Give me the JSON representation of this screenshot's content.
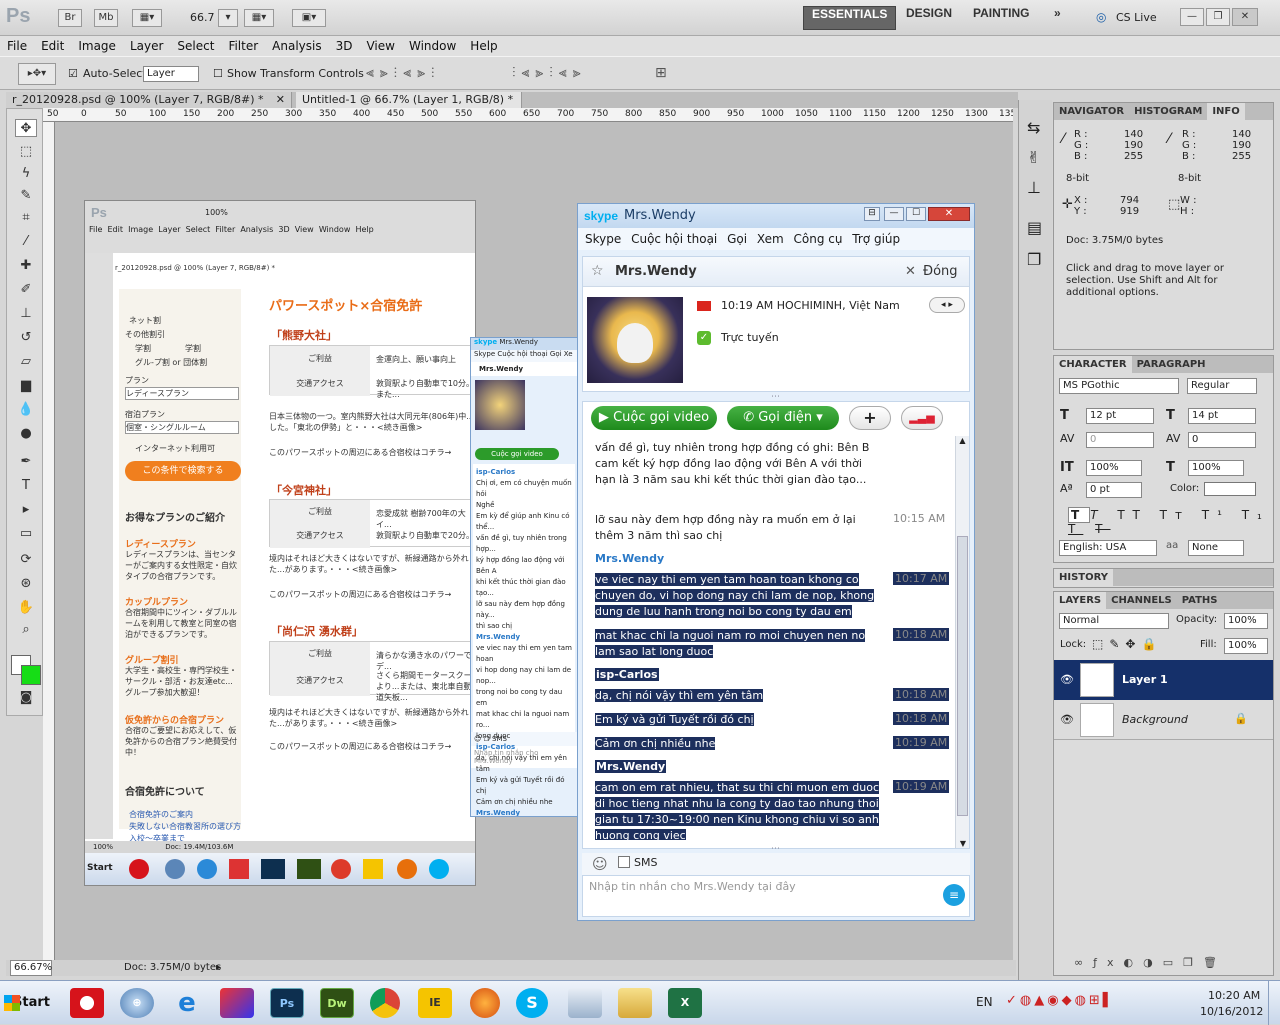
{
  "ps": {
    "logo": "Ps",
    "zoom": "66.7",
    "br": "Br",
    "mb": "Mb",
    "workspaces": [
      "ESSENTIALS",
      "DESIGN",
      "PAINTING"
    ],
    "cslive": "CS Live",
    "menu": [
      "File",
      "Edit",
      "Image",
      "Layer",
      "Select",
      "Filter",
      "Analysis",
      "3D",
      "View",
      "Window",
      "Help"
    ],
    "options": {
      "auto_select": "Auto-Select:",
      "auto_select_value": "Layer",
      "show_transform": "Show Transform Controls"
    },
    "doc_tabs": [
      "r_20120928.psd @ 100% (Layer 7, RGB/8#) *",
      "Untitled-1 @ 66.7% (Layer 1, RGB/8) *"
    ],
    "ruler": [
      "50",
      "0",
      "50",
      "100",
      "150",
      "200",
      "250",
      "300",
      "350",
      "400",
      "450",
      "500",
      "550",
      "600",
      "650",
      "700",
      "750",
      "800",
      "850",
      "900",
      "950",
      "1000",
      "1050",
      "1100",
      "1150",
      "1200",
      "1250",
      "1300",
      "135"
    ],
    "status_zoom": "66.67%",
    "status_doc": "Doc: 3.75M/0 bytes"
  },
  "panels": {
    "info_tabs": [
      "NAVIGATOR",
      "HISTOGRAM",
      "INFO"
    ],
    "info": {
      "r_lbl": "R :",
      "g_lbl": "G :",
      "b_lbl": "B :",
      "r": "140",
      "g": "190",
      "b": "255",
      "bit": "8-bit",
      "x_lbl": "X :",
      "y_lbl": "Y :",
      "x": "794",
      "y": "919",
      "w_lbl": "W :",
      "h_lbl": "H :",
      "doc": "Doc: 3.75M/0 bytes",
      "hint": "Click and drag to move layer or selection. Use Shift and Alt for additional options."
    },
    "char_tabs": [
      "CHARACTER",
      "PARAGRAPH"
    ],
    "char": {
      "font": "MS PGothic",
      "style": "Regular",
      "size": "12 pt",
      "leading": "14 pt",
      "kerning": "0",
      "tracking": "0",
      "vscale": "100%",
      "hscale": "100%",
      "baseline": "0 pt",
      "color_lbl": "Color:",
      "lang": "English: USA",
      "aa": "None",
      "aa_lbl": "aa"
    },
    "history": "HISTORY",
    "layer_tabs": [
      "LAYERS",
      "CHANNELS",
      "PATHS"
    ],
    "layers": {
      "mode": "Normal",
      "opacity_lbl": "Opacity:",
      "opacity": "100%",
      "lock_lbl": "Lock:",
      "fill_lbl": "Fill:",
      "fill": "100%",
      "items": [
        "Layer 1",
        "Background"
      ]
    }
  },
  "inner": {
    "logo": "Ps",
    "zoom": "100%",
    "menu": [
      "File",
      "Edit",
      "Image",
      "Layer",
      "Select",
      "Filter",
      "Analysis",
      "3D",
      "View",
      "Window",
      "Help"
    ],
    "tab": "r_20120928.psd @ 100% (Layer 7, RGB/8#) *",
    "status": "Doc: 19.4M/103.6M",
    "status_zoom": "100%",
    "heading": "パワースポット×合宿免許",
    "sections": [
      {
        "title": "「熊野大社」",
        "benefit": "金運向上、願い事向上",
        "access": "敦賀駅より自動車で10分。また...",
        "desc": "日本三体物の一つ。室内熊野大社は大同元年(806年)中...した。「東北の伊勢」と・・・<続き画像>",
        "more": "このパワースポットの周辺にある合宿校はコチラ→"
      },
      {
        "title": "「今宮神社」",
        "benefit": "恋愛成就 樹齢700年の大イ...",
        "access": "敦賀駅より自動車で20分。",
        "desc": "境内はそれほど大きくはないですが、新緑通路から外れた...があります。・・・<続き画像>",
        "more": "このパワースポットの周辺にある合宿校はコチラ→"
      },
      {
        "title": "「尚仁沢 湧水群」",
        "benefit": "清らかな湧き水のパワーでデ...",
        "access": "さくら期間モータースクールより...または、東北車自動車道矢板...",
        "desc": "境内はそれほど大きくはないですが、新緑通路から外れた...があります。・・・<続き画像>",
        "more": "このパワースポットの周辺にある合宿校はコチラ→"
      }
    ],
    "benefit_lbl": "ご利益",
    "access_lbl": "交通アクセス",
    "left": {
      "net": "ネット割",
      "other": "その他割引",
      "student": "学割",
      "school": "学割",
      "group": "グル-プ割 or 団体割",
      "plan": "プラン",
      "plan_val": "レディースプラン",
      "room": "宿泊プラン",
      "room_val": "個室・シングルルーム",
      "internet": "インターネット利用可",
      "search": "この条件で検索する",
      "intro": "お得なプランのご紹介",
      "p1": "レディースプラン",
      "p1d": "レディースプランは、当センターがご案内する女性限定・自炊タイプの合宿プランです。",
      "p2": "カップルプラン",
      "p2d": "合宿期間中にツイン・ダブルルームを利用して教室と同室の宿泊ができるプランです。",
      "p3": "グループ割引",
      "p3d": "大学生・高校生・専門学校生・サークル・部活・お友達etc...グループ参加大歓迎！",
      "p4": "仮免許からの合宿プラン",
      "p4d": "合宿のご要望にお応えして、仮免許からの合宿プラン絶賛受付中！",
      "about": "合宿免許について",
      "a1": "合宿免許のご案内",
      "a2": "失敗しない合宿教習所の選び方",
      "a3": "入校～卒業まで"
    },
    "task_start": "Start"
  },
  "small_skype": {
    "brand": "skype",
    "title": "Mrs.Wendy",
    "menu": [
      "Skype",
      "Cuộc hội thoại",
      "Gọi",
      "Xe"
    ],
    "name": "Mrs.Wendy",
    "video": "Cuộc gọi video",
    "lines": [
      "isp-Carlos",
      "Chị ơi, em có chuyện muốn hỏi",
      "Nghề",
      "Em kỳ để giúp anh Kinu có thể...",
      "vấn đề gì, tuy nhiên trong hợp...",
      "ký hợp đồng lao động với Bên A",
      "khi kết thúc thời gian đào tạo...",
      "lỡ sau này đem hợp đồng này...",
      "thì sao chị",
      "Mrs.Wendy",
      "ve viec nay thi em yen tam hoan",
      "vi hop dong nay chi lam de nop...",
      "trong noi bo cong ty dau em",
      "mat khac chi la nguoi nam ro...",
      "long duoc",
      "isp-Carlos",
      "dạ, chị nói vậy thì em yên tâm",
      "Em ký và gửi Tuyết rồi đó chị",
      "Cảm ơn chị nhiều nhe",
      "Mrs.Wendy"
    ],
    "sms": "SMS",
    "input": "Nhập tin nhắn cho Mrs.Wendy"
  },
  "skype": {
    "brand": "skype",
    "title": "Mrs.Wendy",
    "menu": [
      "Skype",
      "Cuộc hội thoại",
      "Gọi",
      "Xem",
      "Công cụ",
      "Trợ giúp"
    ],
    "contact_name": "Mrs.Wendy",
    "close": "Đóng",
    "local_time": "10:19 AM HOCHIMINH, Việt Nam",
    "status": "Trực tuyến",
    "video_btn": "Cuộc gọi video",
    "call_btn": "Gọi điện",
    "add_btn": "+",
    "messages": [
      {
        "text": "vấn đề gì, tuy nhiên trong hợp đồng có ghi: Bên B cam kết ký hợp đồng lao động với Bên A với thời hạn là 3 năm sau khi kết thúc thời gian đào tạo...",
        "time": "",
        "sel": false
      },
      {
        "text": "lỡ sau này đem hợp đồng này ra muốn em ở lại thêm 3 năm thì sao chị",
        "time": "10:15 AM",
        "sel": false
      },
      {
        "name": "Mrs.Wendy"
      },
      {
        "text": "ve viec nay thi em yen tam hoan toan khong co chuyen do, vi hop dong nay chi lam de nop, khong dung de luu hanh trong noi bo cong ty dau em",
        "time": "10:17 AM",
        "sel": true
      },
      {
        "text": "mat khac chi la nguoi nam ro moi chuyen nen no lam sao lat long duoc",
        "time": "10:18 AM",
        "sel": true
      },
      {
        "name": "isp-Carlos"
      },
      {
        "text": "dạ, chị nói vậy thì em yên tâm",
        "time": "10:18 AM",
        "sel": true
      },
      {
        "text": "Em ký và gửi Tuyết rồi đó chị",
        "time": "10:18 AM",
        "sel": true
      },
      {
        "text": "Cảm ơn chị nhiều nhe",
        "time": "10:19 AM",
        "sel": true
      },
      {
        "name": "Mrs.Wendy"
      },
      {
        "text": "cam on em rat nhieu, that su thi chi muon em duoc di hoc tieng nhat nhu la cong ty dao tao nhung thoi gian tu 17:30~19:00 nen Kinu khong chiu vi so anh huong cong viec",
        "time": "10:19 AM",
        "sel": true
      }
    ],
    "sms": "SMS",
    "input_placeholder": "Nhập tin nhắn cho Mrs.Wendy tại đây"
  },
  "taskbar": {
    "start": "Start",
    "apps": [
      "O",
      "Safari",
      "e",
      "Paint",
      "Ps",
      "Dw",
      "Chrome",
      "IE",
      "Firefox",
      "S",
      "Note",
      "Folder",
      "X"
    ],
    "lang": "EN",
    "time": "10:20 AM",
    "date": "10/16/2012"
  }
}
